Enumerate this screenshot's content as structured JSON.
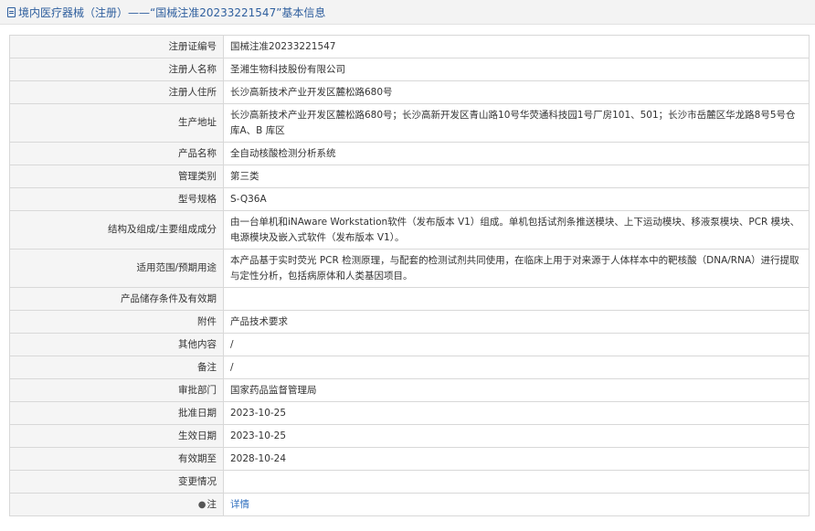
{
  "header": {
    "title": "境内医疗器械（注册）——“国械注准20233221547”基本信息"
  },
  "rows": [
    {
      "label": "注册证编号",
      "value": "国械注准20233221547"
    },
    {
      "label": "注册人名称",
      "value": "圣湘生物科技股份有限公司"
    },
    {
      "label": "注册人住所",
      "value": "长沙高新技术产业开发区麓松路680号"
    },
    {
      "label": "生产地址",
      "value": "长沙高新技术产业开发区麓松路680号；长沙高新开发区青山路10号华荧通科技园1号厂房101、501；长沙市岳麓区华龙路8号5号仓库A、B 库区"
    },
    {
      "label": "产品名称",
      "value": "全自动核酸检测分析系统"
    },
    {
      "label": "管理类别",
      "value": "第三类"
    },
    {
      "label": "型号规格",
      "value": "S-Q36A"
    },
    {
      "label": "结构及组成/主要组成成分",
      "value": "由一台单机和iNAware Workstation软件（发布版本 V1）组成。单机包括试剂条推送模块、上下运动模块、移液泵模块、PCR 模块、电源模块及嵌入式软件（发布版本 V1）。"
    },
    {
      "label": "适用范围/预期用途",
      "value": "本产品基于实时荧光 PCR 检测原理，与配套的检测试剂共同使用，在临床上用于对来源于人体样本中的靶核酸（DNA/RNA）进行提取与定性分析，包括病原体和人类基因项目。"
    },
    {
      "label": "产品储存条件及有效期",
      "value": ""
    },
    {
      "label": "附件",
      "value": "产品技术要求"
    },
    {
      "label": "其他内容",
      "value": "/"
    },
    {
      "label": "备注",
      "value": "/"
    },
    {
      "label": "审批部门",
      "value": "国家药品监督管理局"
    },
    {
      "label": "批准日期",
      "value": "2023-10-25"
    },
    {
      "label": "生效日期",
      "value": "2023-10-25"
    },
    {
      "label": "有效期至",
      "value": "2028-10-24"
    },
    {
      "label": "变更情况",
      "value": ""
    },
    {
      "label": "注",
      "value": "详情"
    }
  ]
}
